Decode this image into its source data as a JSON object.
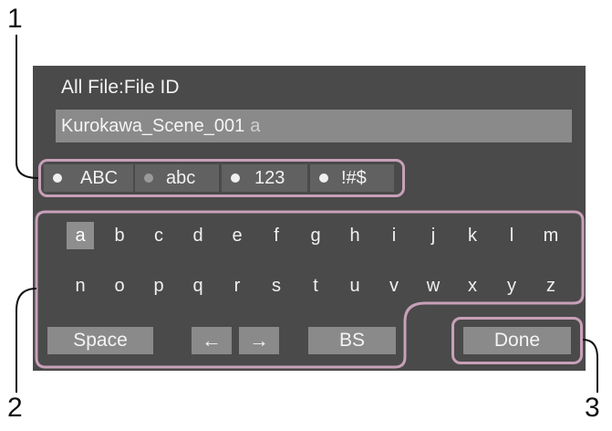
{
  "callouts": [
    "1",
    "2",
    "3"
  ],
  "screen": {
    "title": "All File:File ID",
    "file_id_value": "Kurokawa_Scene_001",
    "cursor_char": "a"
  },
  "modes": [
    {
      "label": "ABC",
      "dot": "bright"
    },
    {
      "label": "abc",
      "dot": "dim"
    },
    {
      "label": "123",
      "dot": "bright"
    },
    {
      "label": "!#$",
      "dot": "bright"
    }
  ],
  "keyboard": {
    "row1": [
      "a",
      "b",
      "c",
      "d",
      "e",
      "f",
      "g",
      "h",
      "i",
      "j",
      "k",
      "l",
      "m"
    ],
    "row2": [
      "n",
      "o",
      "p",
      "q",
      "r",
      "s",
      "t",
      "u",
      "v",
      "w",
      "x",
      "y",
      "z"
    ],
    "selected_key": "a"
  },
  "buttons": {
    "space": "Space",
    "left_arrow": "←",
    "right_arrow": "→",
    "backspace": "BS",
    "done": "Done"
  },
  "colors": {
    "screen_bg": "#4a4a4a",
    "field_bg": "#8a8a8a",
    "highlight_outline": "#c8a0b8"
  }
}
